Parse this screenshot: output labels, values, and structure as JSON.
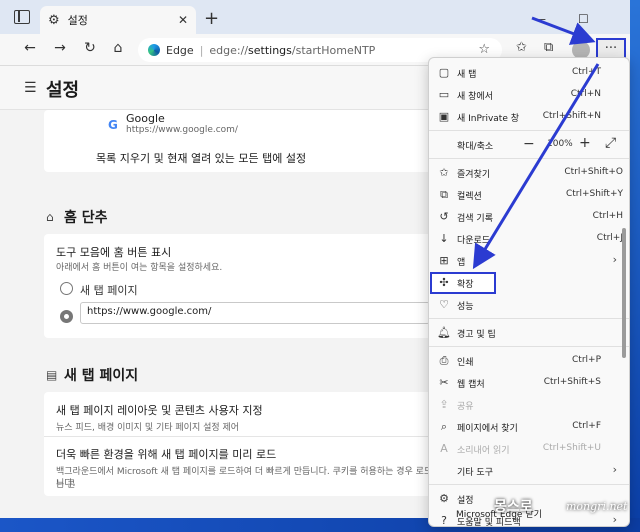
{
  "browser": {
    "tab_title": "설정",
    "address": {
      "brand": "Edge",
      "separator": "|",
      "prefix": "edge://",
      "path": "settings",
      "suffix": "/startHomeNTP"
    },
    "icons": [
      "tab-actions-icon",
      "gear-icon",
      "close-icon",
      "plus-icon",
      "minimize-icon",
      "maximize-icon",
      "back-icon",
      "forward-icon",
      "refresh-icon",
      "home-icon",
      "star-icon",
      "favorites-icon",
      "collections-icon",
      "more-icon"
    ],
    "more_glyph": "···"
  },
  "settings": {
    "title": "설정",
    "search_engine": {
      "name": "Google",
      "url": "https://www.google.com/"
    },
    "clear_label": "목록 지우기 및 현재 열려 있는 모든 탭에 설정",
    "home_section": {
      "title": "홈 단추",
      "row_title": "도구 모음에 홈 버튼 표시",
      "row_desc": "아래에서 홈 버튼이 여는 항목을 설정하세요.",
      "option_newtab": "새 탭 페이지",
      "option_url_value": "https://www.google.com/"
    },
    "ntp_section": {
      "title": "새 탭 페이지",
      "row1_title": "새 탭 페이지 레이아웃 및 콘텐츠 사용자 지정",
      "row1_desc": "뉴스 피드, 배경 이미지 및 기타 페이지 설정 제어",
      "row2_title": "더욱 빠른 환경을 위해 새 탭 페이지를 미리 로드",
      "row2_desc_1": "백그라운드에서 Microsoft 새 탭 페이지를 로드하여 더 빠르게 만듭니다. 쿠키를 허용하는 경우 로드되는 콘",
      "row2_desc_2": "니다."
    }
  },
  "menu": {
    "new_tab": {
      "label": "새 탭",
      "shortcut": "Ctrl+T"
    },
    "new_window": {
      "label": "새 창에서",
      "shortcut": "Ctrl+N"
    },
    "new_private": {
      "label": "새 InPrivate 창",
      "shortcut": "Ctrl+Shift+N"
    },
    "zoom": {
      "label": "확대/축소",
      "minus": "−",
      "value": "100%",
      "plus": "+",
      "expand": "⤢"
    },
    "favorites": {
      "label": "즐겨찾기",
      "shortcut": "Ctrl+Shift+O"
    },
    "collections": {
      "label": "컬렉션",
      "shortcut": "Ctrl+Shift+Y"
    },
    "history": {
      "label": "검색 기록",
      "shortcut": "Ctrl+H"
    },
    "downloads": {
      "label": "다운로드",
      "shortcut": "Ctrl+J"
    },
    "apps": {
      "label": "앱"
    },
    "extensions": {
      "label": "확장"
    },
    "performance": {
      "label": "성능"
    },
    "alerts": {
      "label": "경고 및 팁"
    },
    "print": {
      "label": "인쇄",
      "shortcut": "Ctrl+P"
    },
    "web_capture": {
      "label": "웹 캡처",
      "shortcut": "Ctrl+Shift+S"
    },
    "share": {
      "label": "공유"
    },
    "find": {
      "label": "페이지에서 찾기",
      "shortcut": "Ctrl+F"
    },
    "read_aloud": {
      "label": "소리내어 읽기",
      "shortcut": "Ctrl+Shift+U"
    },
    "more_tools": {
      "label": "기타 도구"
    },
    "settings": {
      "label": "설정"
    },
    "help": {
      "label": "도움말 및 피드백"
    },
    "close_edge": {
      "label": "Microsoft Edge 닫기"
    }
  },
  "watermark": {
    "text1": "몽스로",
    "text2": "mongri.net"
  },
  "colors": {
    "annotation": "#2b3bd1",
    "accent": "#0c59a4"
  }
}
